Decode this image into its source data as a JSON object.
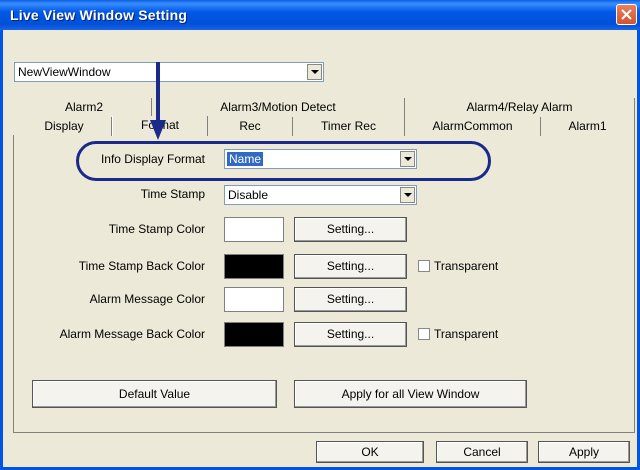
{
  "window": {
    "title": "Live View Window Setting",
    "view_window_select": "NewViewWindow"
  },
  "tabs": {
    "row_back": [
      "Alarm2",
      "Alarm3/Motion Detect",
      "Alarm4/Relay Alarm"
    ],
    "row_front": [
      "Display",
      "Format",
      "Rec",
      "Timer Rec",
      "AlarmCommon",
      "Alarm1"
    ],
    "active": "Format"
  },
  "format": {
    "info_display_format_label": "Info Display Format",
    "info_display_format_value": "Name",
    "time_stamp_label": "Time Stamp",
    "time_stamp_value": "Disable",
    "time_stamp_color_label": "Time Stamp Color",
    "time_stamp_color": "#ffffff",
    "time_stamp_back_color_label": "Time Stamp Back Color",
    "time_stamp_back_color": "#000000",
    "alarm_message_color_label": "Alarm Message Color",
    "alarm_message_color": "#ffffff",
    "alarm_message_back_color_label": "Alarm Message Back Color",
    "alarm_message_back_color": "#000000",
    "setting_label": "Setting...",
    "transparent_label": "Transparent",
    "default_value_label": "Default Value",
    "apply_all_label": "Apply for all View Window"
  },
  "footer": {
    "ok": "OK",
    "cancel": "Cancel",
    "apply": "Apply"
  },
  "colors": {
    "titlebar": "#0055e5",
    "dialog_bg": "#ece9d8",
    "selection": "#316ac5",
    "highlight_annotation": "#1a2a8a"
  }
}
